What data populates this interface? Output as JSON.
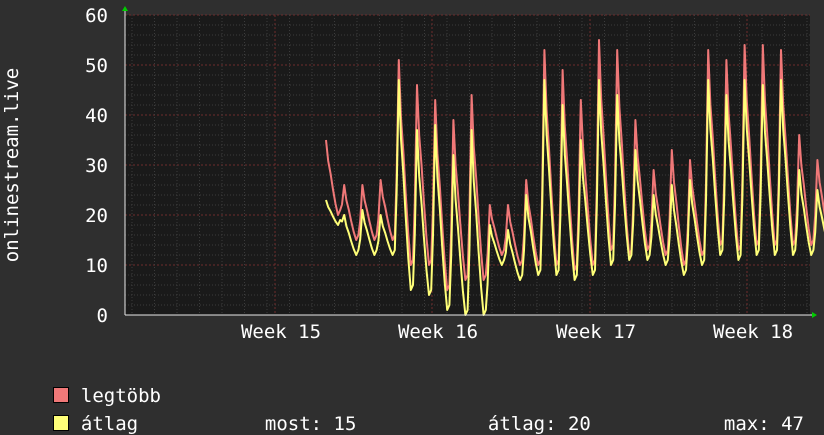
{
  "chart_data": {
    "type": "line",
    "ylabel": "onlinestream.live",
    "ylim": [
      0,
      60
    ],
    "yticks": [
      0,
      10,
      20,
      30,
      40,
      50,
      60
    ],
    "x_tick_labels": [
      "Week 15",
      "Week 16",
      "Week 17",
      "Week 18"
    ],
    "grid": true,
    "legend_placement": "bottom-left",
    "series": [
      {
        "name": "legtöbb",
        "color": "#f07878"
      },
      {
        "name": "átlag",
        "color": "#ffff78"
      }
    ],
    "daily_peaks": {
      "max": [
        35,
        26,
        26,
        27,
        51,
        46,
        43,
        39,
        44,
        22,
        22,
        27,
        53,
        49,
        43,
        55,
        53,
        39,
        29,
        33,
        31,
        53,
        51,
        54,
        54,
        53,
        36,
        31
      ],
      "mean": [
        23,
        20,
        21,
        20,
        47,
        37,
        38,
        32,
        37,
        18,
        17,
        24,
        47,
        42,
        35,
        47,
        44,
        33,
        24,
        26,
        27,
        47,
        44,
        47,
        46,
        47,
        29,
        25
      ]
    },
    "daily_lows": {
      "max": [
        20,
        15,
        15,
        15,
        10,
        10,
        5,
        7,
        7,
        12,
        10,
        10,
        10,
        9,
        10,
        13,
        12,
        13,
        12,
        10,
        12,
        14,
        13,
        14,
        14,
        14,
        14,
        15
      ],
      "mean": [
        18,
        12,
        12,
        12,
        5,
        4,
        1,
        0,
        0,
        10,
        7,
        8,
        8,
        7,
        8,
        10,
        11,
        11,
        10,
        8,
        10,
        12,
        11,
        12,
        12,
        12,
        12,
        13
      ]
    },
    "stats": {
      "most_label": "most:",
      "most_value": "15",
      "atlag_label": "átlag:",
      "atlag_value": "20",
      "max_label": "max:",
      "max_value": "47"
    }
  }
}
